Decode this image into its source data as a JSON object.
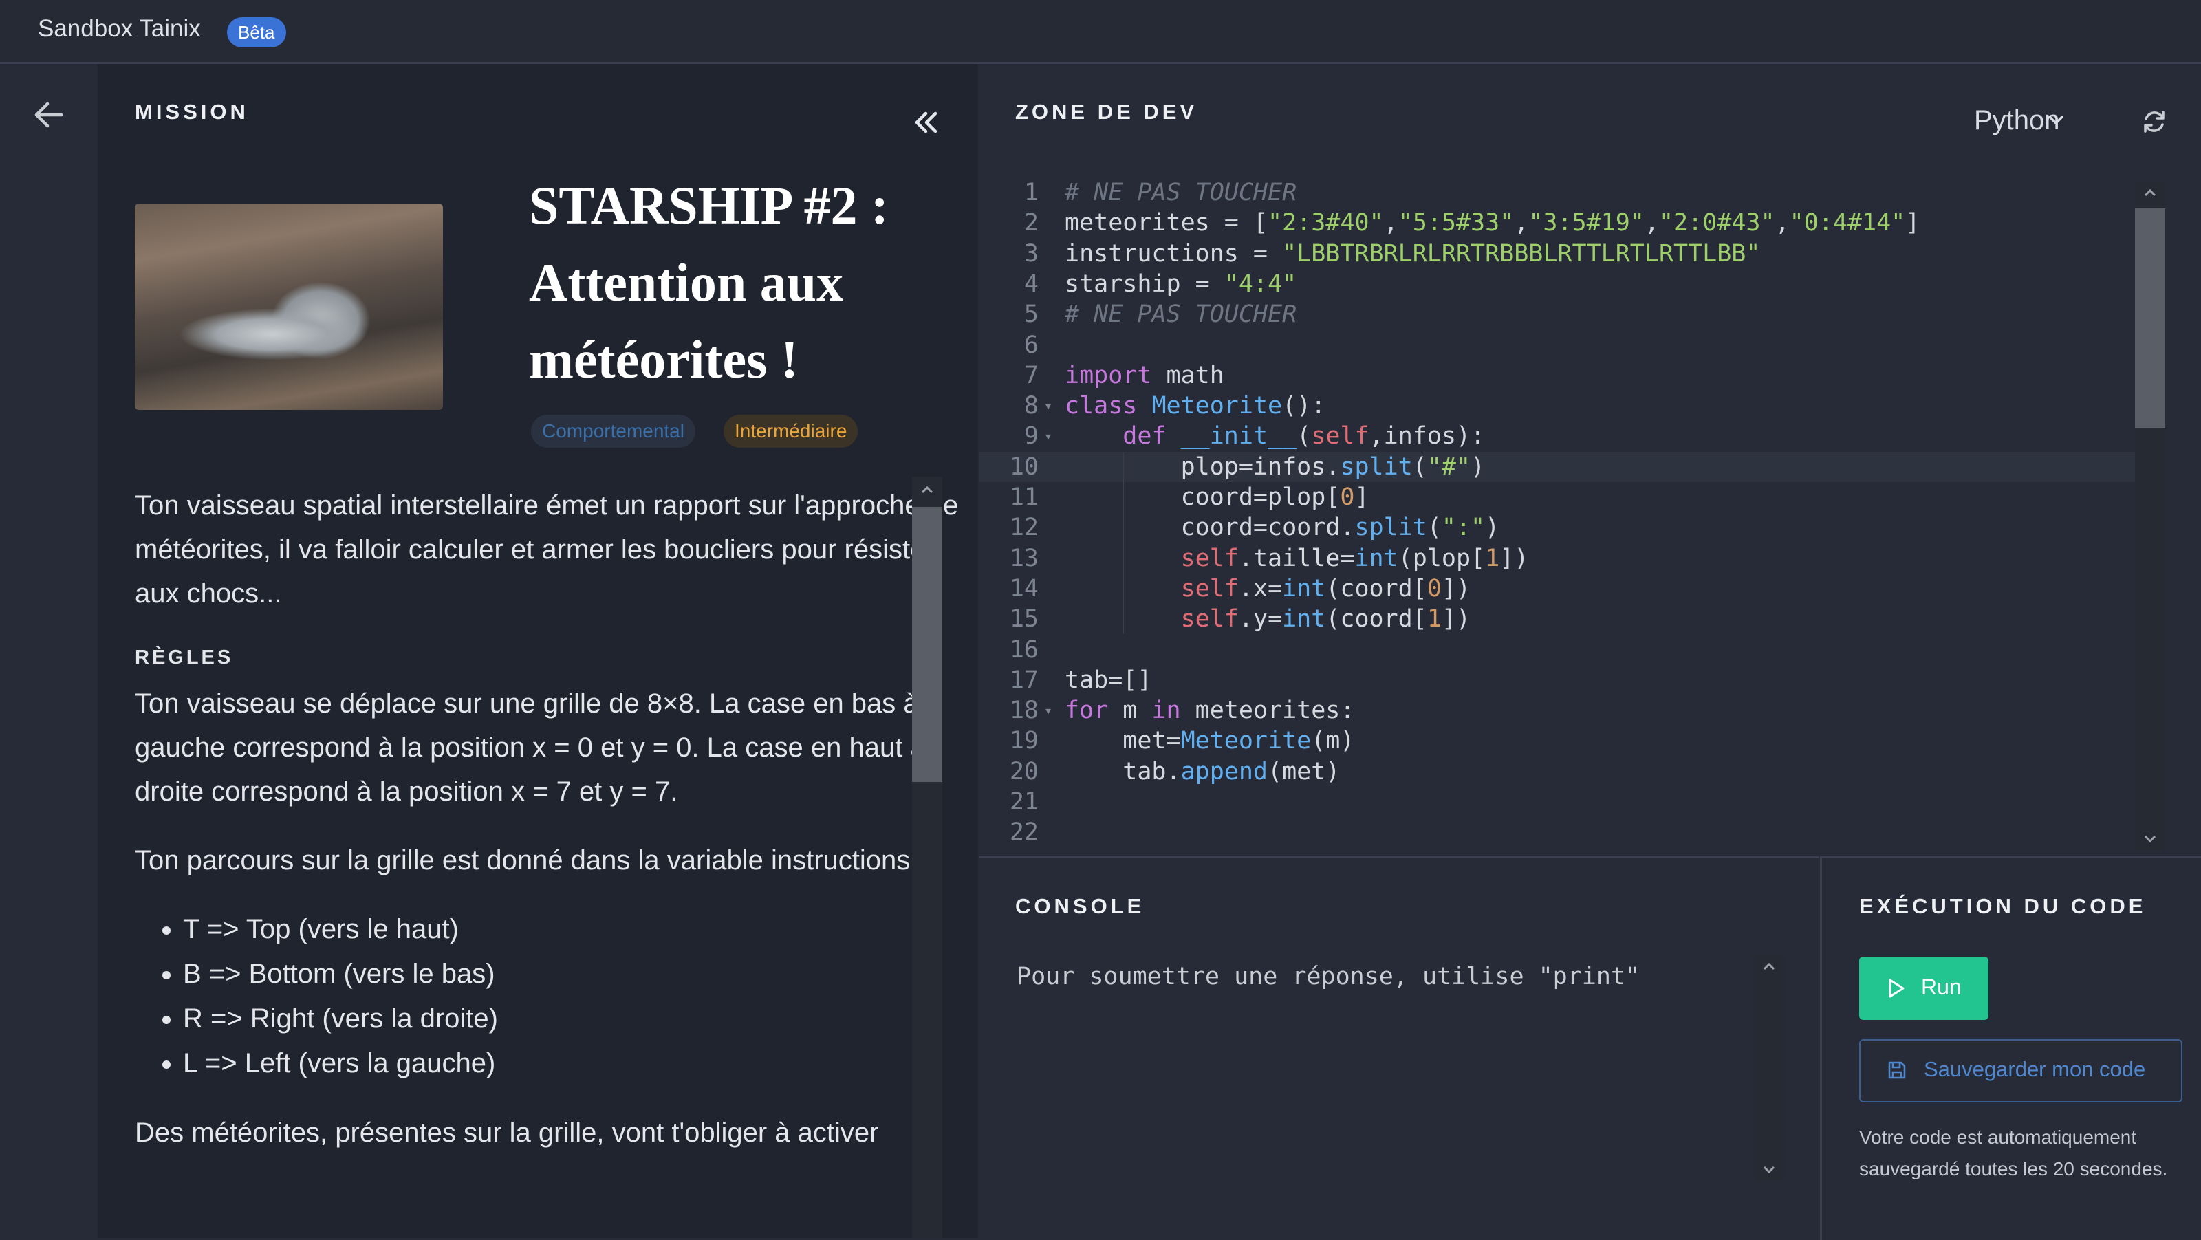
{
  "app": {
    "title": "Sandbox Tainix",
    "badge": "Bêta"
  },
  "mission": {
    "section_title": "MISSION",
    "title": "STARSHIP #2 : Attention aux météorites !",
    "tags": [
      "Comportemental",
      "Intermédiaire"
    ],
    "intro": "Ton vaisseau spatial interstellaire émet un rapport sur l'approche de météorites, il va falloir calculer et armer les boucliers pour résister aux chocs...",
    "rules_heading": "RÈGLES",
    "rules_p1": "Ton vaisseau se déplace sur une grille de 8×8. La case en bas à gauche correspond à la position x = 0 et y = 0. La case en haut à droite correspond à la position x = 7 et y = 7.",
    "rules_p2": "Ton parcours sur la grille est donné dans la variable instructions :",
    "instructions_list": [
      "T => Top (vers le haut)",
      "B => Bottom (vers le bas)",
      "R => Right (vers la droite)",
      "L => Left (vers la gauche)"
    ],
    "rules_p3": "Des météorites, présentes sur la grille, vont t'obliger à activer"
  },
  "dev": {
    "section_title": "ZONE DE DEV",
    "language": "Python",
    "active_line": 10,
    "code_lines": [
      "# NE PAS TOUCHER",
      "meteorites = [\"2:3#40\",\"5:5#33\",\"3:5#19\",\"2:0#43\",\"0:4#14\"]",
      "instructions = \"LBBTRBRLRLRRTRBBBLRTTLRTLRTTLBB\"",
      "starship = \"4:4\"",
      "# NE PAS TOUCHER",
      "",
      "import math",
      "class Meteorite():",
      "    def __init__(self,infos):",
      "        plop=infos.split(\"#\")",
      "        coord=plop[0]",
      "        coord=coord.split(\":\")",
      "        self.taille=int(plop[1])",
      "        self.x=int(coord[0])",
      "        self.y=int(coord[1])",
      "",
      "tab=[]",
      "for m in meteorites:",
      "    met=Meteorite(m)",
      "    tab.append(met)",
      "",
      ""
    ]
  },
  "console": {
    "section_title": "CONSOLE",
    "text": "Pour soumettre une réponse, utilise \"print\""
  },
  "execution": {
    "section_title": "EXÉCUTION DU CODE",
    "run_label": "Run",
    "save_label": "Sauvegarder mon code",
    "autosave_note": "Votre code est automatiquement sauvegardé toutes les 20 secondes."
  },
  "icons": [
    "back-arrow-icon",
    "double-chevron-left-icon",
    "chevron-down-icon",
    "refresh-icon",
    "play-icon",
    "floppy-icon"
  ],
  "colors": {
    "accent_run": "#22c48f",
    "badge": "#3b72d6",
    "tag_intermediate": "#e9a43a",
    "tag_behavioral": "#3a6fa8"
  }
}
